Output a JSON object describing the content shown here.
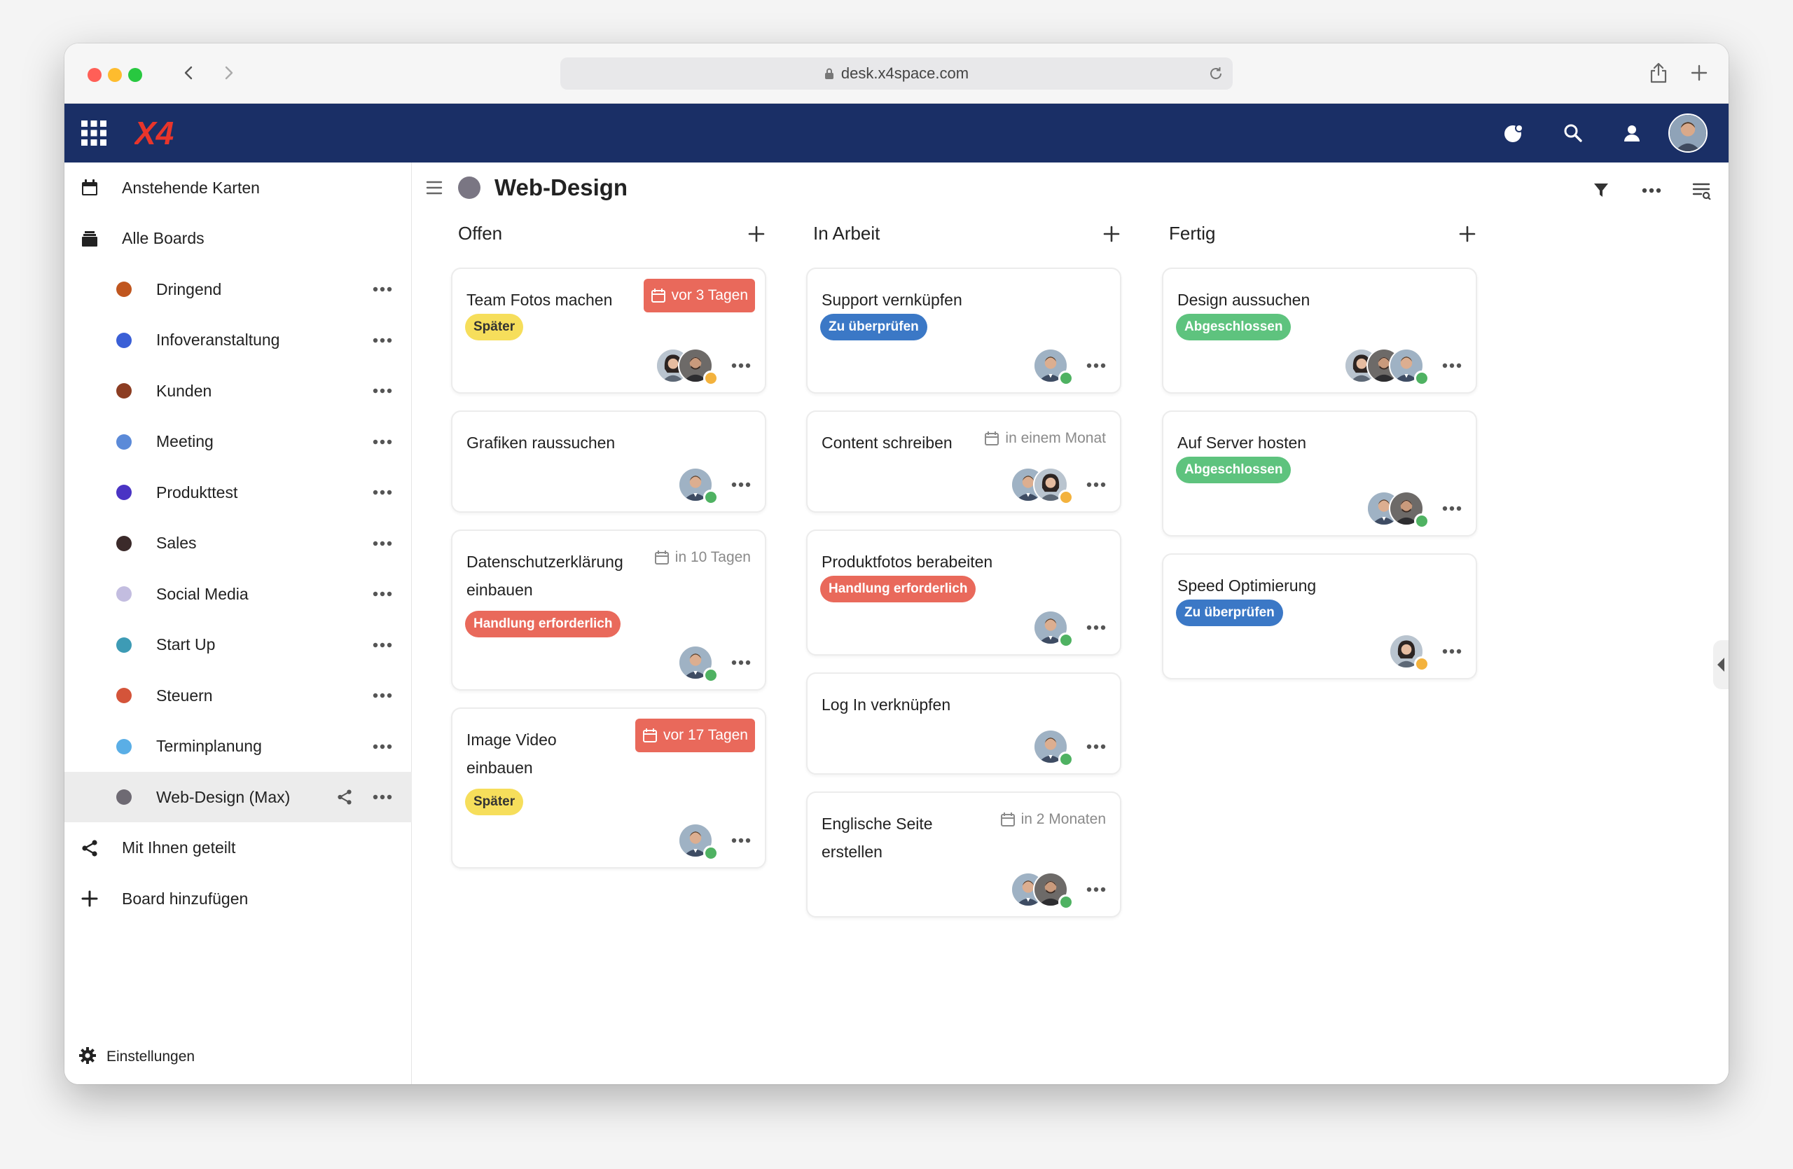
{
  "browser": {
    "url": "desk.x4space.com"
  },
  "app": {
    "logo": "X4"
  },
  "sidebar": {
    "top_items": [
      {
        "label": "Anstehende Karten",
        "icon": "calendar-icon"
      },
      {
        "label": "Alle Boards",
        "icon": "boards-icon"
      }
    ],
    "boards": [
      {
        "label": "Dringend",
        "color": "#c0561f"
      },
      {
        "label": "Infoveranstaltung",
        "color": "#3a5fd6"
      },
      {
        "label": "Kunden",
        "color": "#8c3d22"
      },
      {
        "label": "Meeting",
        "color": "#5b8ad8"
      },
      {
        "label": "Produkttest",
        "color": "#4a34c4"
      },
      {
        "label": "Sales",
        "color": "#3b2a2a"
      },
      {
        "label": "Social Media",
        "color": "#c3bde0"
      },
      {
        "label": "Start Up",
        "color": "#3d9bb5"
      },
      {
        "label": "Steuern",
        "color": "#d4543a"
      },
      {
        "label": "Terminplanung",
        "color": "#5aaee6"
      },
      {
        "label": "Web-Design (Max)",
        "color": "#6e6a73"
      }
    ],
    "bottom_items": [
      {
        "label": "Mit Ihnen geteilt",
        "icon": "share-icon"
      },
      {
        "label": "Board hinzufügen",
        "icon": "plus-icon"
      }
    ],
    "settings_label": "Einstellungen"
  },
  "board": {
    "title": "Web-Design",
    "columns": [
      {
        "title": "Offen",
        "cards": [
          {
            "title_lines": [
              "Team Fotos machen"
            ],
            "due": "vor 3 Tagen",
            "due_type": "overdue",
            "tag": "Später",
            "tag_color": "yellow",
            "avatars": [
              "woman",
              "man-dark"
            ],
            "status": "away"
          },
          {
            "title_lines": [
              "Grafiken raussuchen"
            ],
            "due": "",
            "due_type": "",
            "tag": "",
            "tag_color": "",
            "avatars": [
              "man"
            ],
            "status": "online"
          },
          {
            "title_lines": [
              "Datenschutzerklärung",
              "einbauen"
            ],
            "due": "in 10 Tagen",
            "due_type": "soon",
            "tag": "Handlung erforderlich",
            "tag_color": "red",
            "avatars": [
              "man"
            ],
            "status": "online"
          },
          {
            "title_lines": [
              "Image Video",
              "einbauen"
            ],
            "due": "vor 17 Tagen",
            "due_type": "overdue",
            "tag": "Später",
            "tag_color": "yellow",
            "avatars": [
              "man"
            ],
            "status": "online"
          }
        ]
      },
      {
        "title": "In Arbeit",
        "cards": [
          {
            "title_lines": [
              "Support vernküpfen"
            ],
            "due": "",
            "due_type": "",
            "tag": "Zu überprüfen",
            "tag_color": "blue",
            "avatars": [
              "man"
            ],
            "status": "online"
          },
          {
            "title_lines": [
              "Content schreiben"
            ],
            "due": "in einem Monat",
            "due_type": "soon",
            "tag": "",
            "tag_color": "",
            "avatars": [
              "man",
              "woman"
            ],
            "status": "away"
          },
          {
            "title_lines": [
              "Produktfotos berabeiten"
            ],
            "due": "",
            "due_type": "",
            "tag": "Handlung erforderlich",
            "tag_color": "red",
            "avatars": [
              "man"
            ],
            "status": "online"
          },
          {
            "title_lines": [
              "Log In verknüpfen"
            ],
            "due": "",
            "due_type": "",
            "tag": "",
            "tag_color": "",
            "avatars": [
              "man"
            ],
            "status": "online"
          },
          {
            "title_lines": [
              "Englische Seite",
              "erstellen"
            ],
            "due": "in 2 Monaten",
            "due_type": "soon",
            "tag": "",
            "tag_color": "",
            "avatars": [
              "man",
              "man-dark"
            ],
            "status": "online"
          }
        ]
      },
      {
        "title": "Fertig",
        "cards": [
          {
            "title_lines": [
              "Design aussuchen"
            ],
            "due": "",
            "due_type": "",
            "tag": "Abgeschlossen",
            "tag_color": "green",
            "avatars": [
              "woman",
              "man-dark",
              "man"
            ],
            "status": "online"
          },
          {
            "title_lines": [
              "Auf Server hosten"
            ],
            "due": "",
            "due_type": "",
            "tag": "Abgeschlossen",
            "tag_color": "green",
            "avatars": [
              "man",
              "man-dark"
            ],
            "status": "online"
          },
          {
            "title_lines": [
              "Speed Optimierung"
            ],
            "due": "",
            "due_type": "",
            "tag": "Zu überprüfen",
            "tag_color": "blue",
            "avatars": [
              "woman"
            ],
            "status": "away"
          }
        ]
      }
    ]
  }
}
